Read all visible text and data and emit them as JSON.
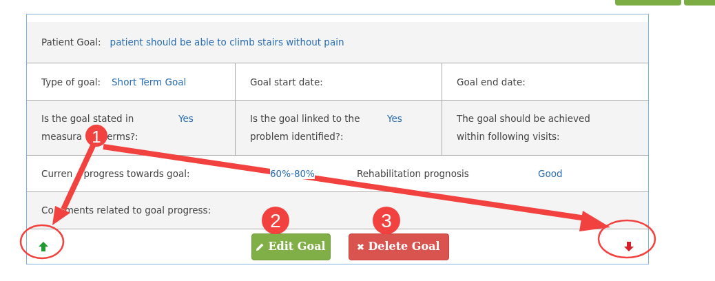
{
  "rows": [
    {
      "kind": "single",
      "cells": [
        {
          "label": "Patient Goal:",
          "value": "patient should be able to climb stairs without pain"
        }
      ]
    },
    {
      "kind": "thirds",
      "cells": [
        {
          "label": "Type of goal:",
          "value": "Short Term Goal"
        },
        {
          "label": "Goal start date:"
        },
        {
          "label": "Goal end date:"
        }
      ]
    },
    {
      "kind": "stacked",
      "cells": [
        {
          "label_lines": [
            [
              "Is the goal stated in"
            ],
            [
              "measura",
              "erms?:"
            ]
          ],
          "value": "Yes"
        },
        {
          "label": "Is the goal linked to the problem identified?:",
          "value": "Yes"
        },
        {
          "label": "The goal should be achieved within following visits:"
        }
      ]
    },
    {
      "kind": "pairs",
      "cells": [
        {
          "label_parts": [
            "Curren",
            "progress towards goal:"
          ],
          "value": "60%-80%"
        },
        {
          "label": "Rehabilitation prognosis",
          "value": "Good"
        }
      ]
    },
    {
      "kind": "single",
      "cells": [
        {
          "label_parts": [
            "Co",
            "ments related to goal progress:"
          ]
        }
      ]
    }
  ],
  "buttons": [
    {
      "kind": "edit",
      "label": "Edit Goal"
    },
    {
      "kind": "delete",
      "label": "Delete Goal"
    }
  ],
  "callouts": [
    {
      "number": "1"
    },
    {
      "number": "2"
    },
    {
      "number": "3"
    }
  ]
}
